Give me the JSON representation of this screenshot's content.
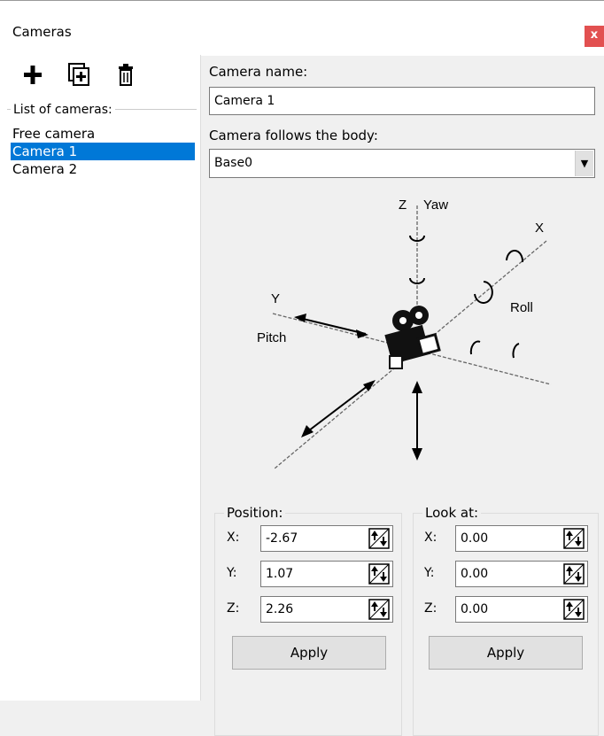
{
  "window": {
    "title": "Cameras",
    "close_label": "x"
  },
  "toolbar": {
    "add_icon": "plus-icon",
    "duplicate_icon": "duplicate-icon",
    "delete_icon": "trash-icon"
  },
  "list": {
    "label": "List of cameras:",
    "items": [
      {
        "label": "Free camera",
        "selected": false
      },
      {
        "label": "Camera 1",
        "selected": true
      },
      {
        "label": "Camera 2",
        "selected": false
      }
    ]
  },
  "camera_name": {
    "label": "Camera name:",
    "value": "Camera 1"
  },
  "follows": {
    "label": "Camera follows the body:",
    "value": "Base0"
  },
  "diagram": {
    "z_label": "Z",
    "yaw_label": "Yaw",
    "x_label": "X",
    "y_label": "Y",
    "pitch_label": "Pitch",
    "roll_label": "Roll"
  },
  "position": {
    "label": "Position:",
    "x_label": "X:",
    "x": "-2.67",
    "y_label": "Y:",
    "y": "1.07",
    "z_label": "Z:",
    "z": "2.26",
    "apply": "Apply"
  },
  "look_at": {
    "label": "Look at:",
    "x_label": "X:",
    "x": "0.00",
    "y_label": "Y:",
    "y": "0.00",
    "z_label": "Z:",
    "z": "0.00",
    "apply": "Apply"
  },
  "colors": {
    "selection": "#0078d7",
    "close": "#e25050"
  }
}
